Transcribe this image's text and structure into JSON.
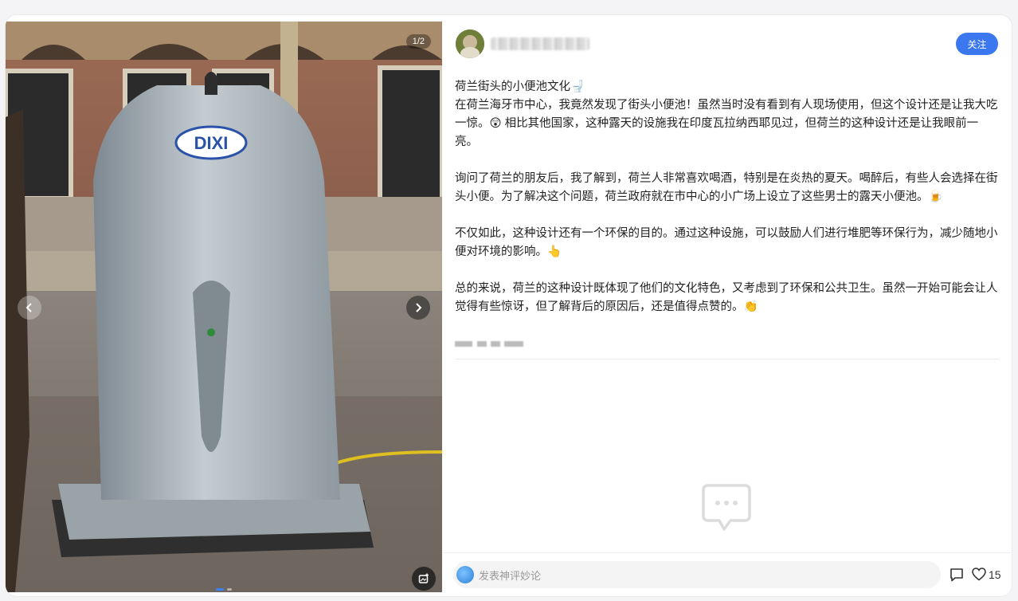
{
  "post": {
    "image_counter": "1/2",
    "image_sign_text": "DIXI",
    "follow_label": "关注",
    "title": "荷兰街头的小便池文化🚽",
    "paragraphs": [
      "在荷兰海牙市中心，我竟然发现了街头小便池！虽然当时没有看到有人现场使用，但这个设计还是让我大吃一惊。😲 相比其他国家，这种露天的设施我在印度瓦拉纳西耶见过，但荷兰的这种设计还是让我眼前一亮。",
      "询问了荷兰的朋友后，我了解到，荷兰人非常喜欢喝酒，特别是在炎热的夏天。喝醉后，有些人会选择在街头小便。为了解决这个问题，荷兰政府就在市中心的小广场上设立了这些男士的露天小便池。🍺",
      "不仅如此，这种设计还有一个环保的目的。通过这种设施，可以鼓励人们进行堆肥等环保行为，减少随地小便对环境的影响。👆",
      "总的来说，荷兰的这种设计既体现了他们的文化特色，又考虑到了环保和公共卫生。虽然一开始可能会让人觉得有些惊讶，但了解背后的原因后，还是值得点赞的。👏"
    ]
  },
  "comments": {
    "placeholder": "发表神评妙论",
    "like_count": "15"
  },
  "colors": {
    "accent": "#3b78f0",
    "text": "#222222"
  }
}
